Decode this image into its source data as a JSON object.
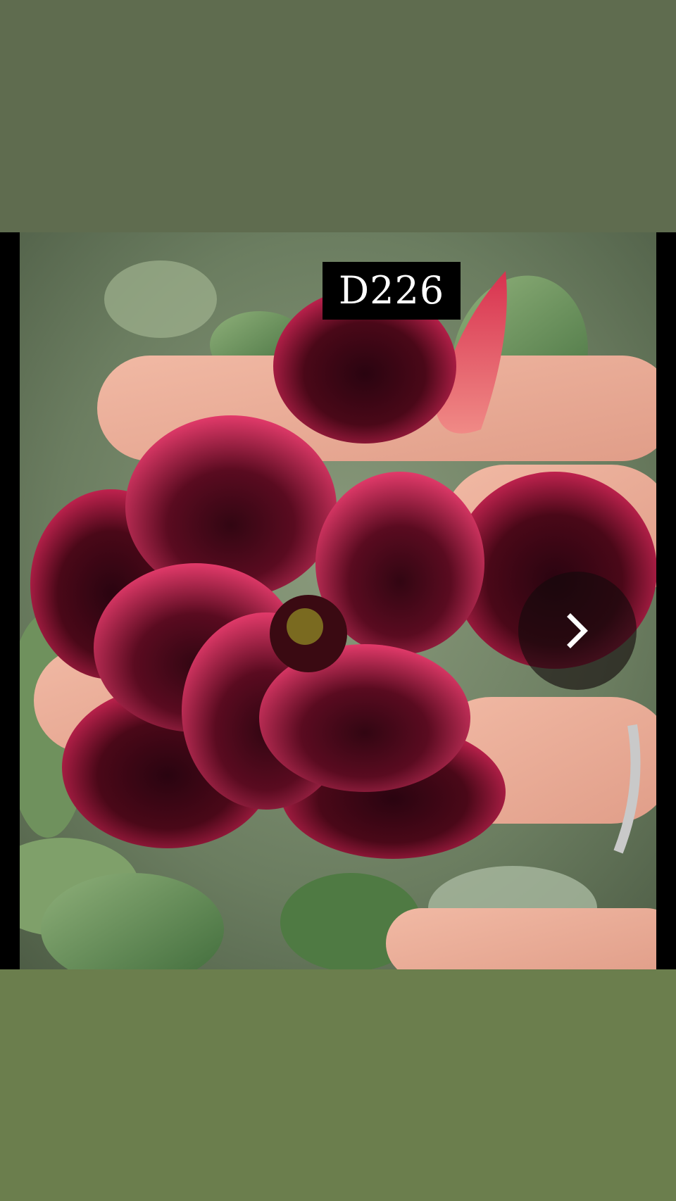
{
  "photo_label": "D226",
  "icons": {
    "next": "chevron-right-icon"
  },
  "colors": {
    "top_band": "#5f6c4f",
    "bottom_band": "#6b7e4d",
    "letterbox": "#000000",
    "label_background": "#000000",
    "label_text": "#ffffff"
  }
}
